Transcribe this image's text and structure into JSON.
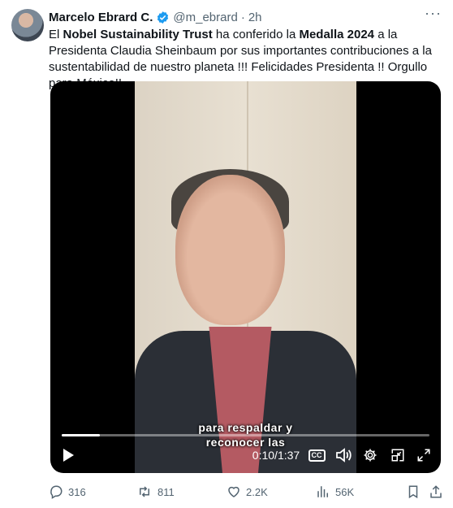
{
  "tweet": {
    "author_name": "Marcelo Ebrard C.",
    "handle": "@m_ebrard",
    "separator": "·",
    "time": "2h",
    "text": {
      "p1": "El ",
      "b1": "Nobel Sustainability Trust",
      "p2": " ha conferido la ",
      "b2": "Medalla 2024",
      "p3": " a la Presidenta Claudia Sheinbaum por sus importantes contribuciones a la sustentabilidad de nuestro planeta !!! Felicidades Presidenta !! Orgullo para México!!"
    }
  },
  "video": {
    "caption_line1": "para respaldar y",
    "caption_line2": "reconocer las",
    "elapsed": "0:10",
    "time_sep": " / ",
    "duration": "1:37",
    "progress": 0.103,
    "cc_label": "CC"
  },
  "actions": {
    "replies": "316",
    "reposts": "811",
    "likes": "2.2K",
    "views": "56K"
  },
  "colors": {
    "verified": "#1d9bf0",
    "muted": "#536471",
    "text": "#0f1419"
  }
}
